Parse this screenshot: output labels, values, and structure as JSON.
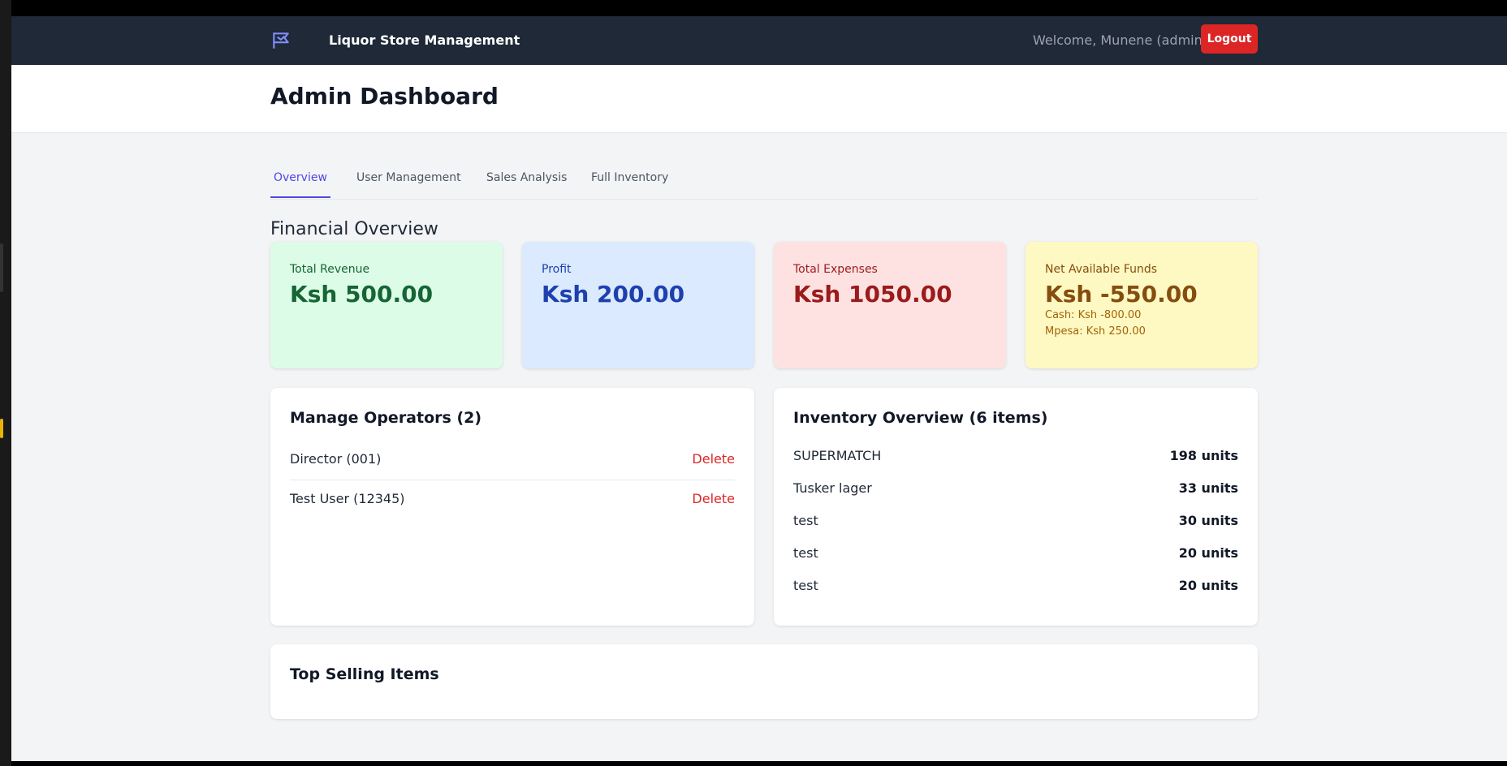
{
  "app": {
    "brand": "Liquor Store Management",
    "welcome": "Welcome, Munene (admin)",
    "logout_label": "Logout"
  },
  "header": {
    "title": "Admin Dashboard"
  },
  "tabs": [
    {
      "label": "Overview",
      "active": true
    },
    {
      "label": "User Management",
      "active": false
    },
    {
      "label": "Sales Analysis",
      "active": false
    },
    {
      "label": "Full Inventory",
      "active": false
    }
  ],
  "financial": {
    "title": "Financial Overview",
    "cards": [
      {
        "label": "Total Revenue",
        "value": "Ksh 500.00",
        "bg": "#dcfce7",
        "fg": "#166534"
      },
      {
        "label": "Profit",
        "value": "Ksh 200.00",
        "bg": "#dbeafe",
        "fg": "#1e40af"
      },
      {
        "label": "Total Expenses",
        "value": "Ksh 1050.00",
        "bg": "#fee2e2",
        "fg": "#991b1b"
      },
      {
        "label": "Net Available Funds",
        "value": "Ksh -550.00",
        "bg": "#fef9c3",
        "fg": "#854d0e",
        "cash": "Cash: Ksh -800.00",
        "mpesa": "Mpesa: Ksh 250.00"
      }
    ]
  },
  "operators": {
    "title": "Manage Operators (2)",
    "items": [
      {
        "name": "Director (001)",
        "action": "Delete"
      },
      {
        "name": "Test User (12345)",
        "action": "Delete"
      }
    ]
  },
  "inventory": {
    "title": "Inventory Overview (6 items)",
    "items": [
      {
        "name": "SUPERMATCH",
        "qty": "198 units"
      },
      {
        "name": "Tusker lager",
        "qty": "33 units"
      },
      {
        "name": "test",
        "qty": "30 units"
      },
      {
        "name": "test",
        "qty": "20 units"
      },
      {
        "name": "test",
        "qty": "20 units"
      }
    ]
  },
  "top_selling": {
    "title": "Top Selling Items"
  },
  "colors": {
    "nav_bg": "#1f2937",
    "accent": "#4f46e5",
    "danger": "#dc2626",
    "page_bg": "#f3f4f6"
  },
  "icons": {
    "logo": "bottle-flag-icon"
  }
}
